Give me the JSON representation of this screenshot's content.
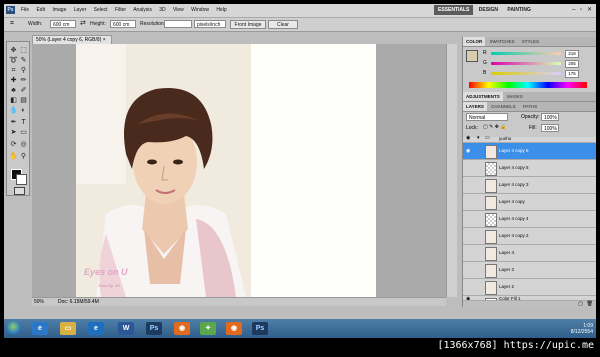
{
  "app": {
    "logo": "Ps"
  },
  "menu": [
    "File",
    "Edit",
    "Image",
    "Layer",
    "Select",
    "Filter",
    "Analysis",
    "3D",
    "View",
    "Window",
    "Help"
  ],
  "workspaces": [
    {
      "label": "ESSENTIALS",
      "active": true
    },
    {
      "label": "DESIGN",
      "active": false
    },
    {
      "label": "PAINTING",
      "active": false
    }
  ],
  "options": {
    "width_label": "Width:",
    "width_value": "600 cm",
    "height_label": "Height:",
    "height_value": "600 cm",
    "resolution_label": "Resolution:",
    "resolution_units": "pixels/inch",
    "front_image_btn": "Front Image",
    "clear_btn": "Clear"
  },
  "document": {
    "tab_title": "50% (Layer 4 copy 6, RGB/8) ×",
    "zoom": "50%",
    "doc_size": "Doc: 6.15M/59.4M",
    "photo_caption": "Eyes on U",
    "photo_credit": "Scan By: JH"
  },
  "color_panel": {
    "tabs": [
      {
        "label": "COLOR",
        "on": true
      },
      {
        "label": "SWATCHES",
        "on": false
      },
      {
        "label": "STYLES",
        "on": false
      }
    ],
    "R": "218",
    "G": "205",
    "B": "175"
  },
  "adjust_tabs": [
    {
      "label": "ADJUSTMENTS",
      "on": true
    },
    {
      "label": "MASKS",
      "on": false
    }
  ],
  "layers_panel": {
    "tabs": [
      {
        "label": "LAYERS",
        "on": true
      },
      {
        "label": "CHANNELS",
        "on": false
      },
      {
        "label": "PATHS",
        "on": false
      }
    ],
    "blend_mode": "Normal",
    "opacity_label": "Opacity:",
    "opacity": "100%",
    "lock_label": "Lock:",
    "fill_label": "Fill:",
    "fill": "100%",
    "group_name": "yunho",
    "layers": [
      {
        "name": "Layer 4 copy 6",
        "selected": true,
        "visible": true
      },
      {
        "name": "Layer 4 copy 5",
        "selected": false,
        "visible": false
      },
      {
        "name": "Layer 4 copy 3",
        "selected": false,
        "visible": false
      },
      {
        "name": "Layer 4 copy",
        "selected": false,
        "visible": false
      },
      {
        "name": "Layer 4 copy 4",
        "selected": false,
        "visible": false
      },
      {
        "name": "Layer 4 copy 2",
        "selected": false,
        "visible": false
      },
      {
        "name": "Layer 4",
        "selected": false,
        "visible": false
      },
      {
        "name": "Layer 3",
        "selected": false,
        "visible": false
      },
      {
        "name": "Layer 2",
        "selected": false,
        "visible": false
      },
      {
        "name": "Color Fill 1",
        "selected": false,
        "visible": true
      }
    ]
  },
  "taskbar": {
    "time": "1:09",
    "date": "8/12/2554"
  },
  "watermark": "[1366x768] https://upic.me"
}
